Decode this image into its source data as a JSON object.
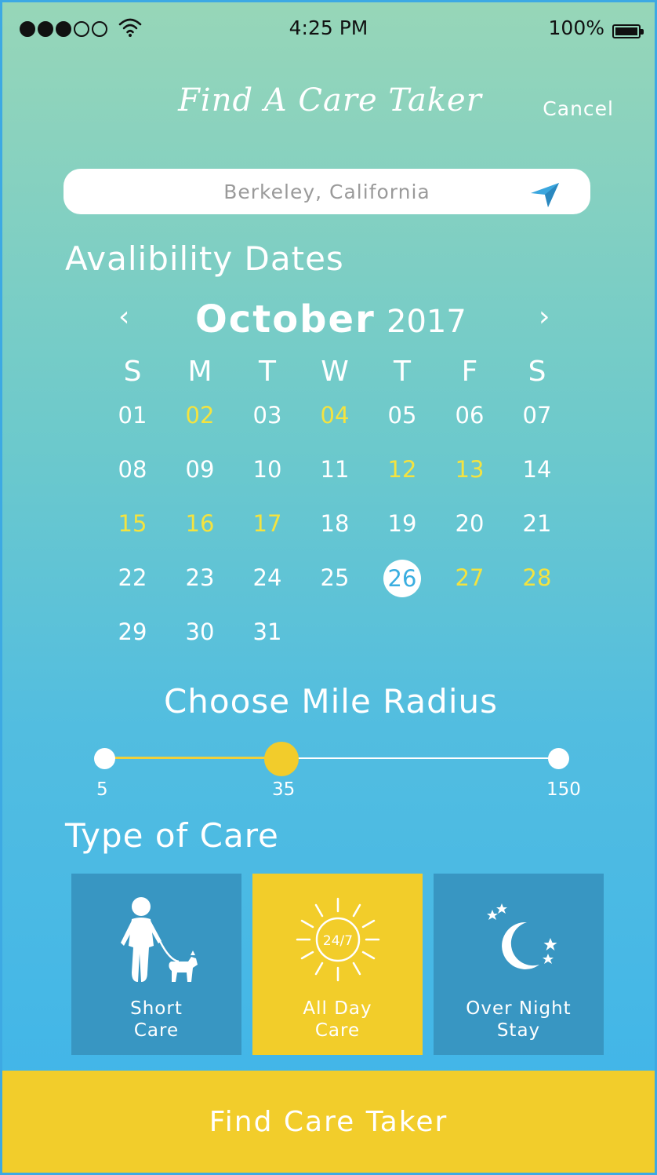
{
  "status_bar": {
    "time": "4:25 PM",
    "battery": "100%"
  },
  "header": {
    "title": "Find A Care Taker",
    "cancel": "Cancel"
  },
  "search": {
    "value": "Berkeley, California"
  },
  "availability": {
    "heading": "Avalibility Dates",
    "month": "October",
    "year": "2017",
    "prev": "‹",
    "next": "›",
    "weekdays": [
      "S",
      "M",
      "T",
      "W",
      "T",
      "F",
      "S"
    ],
    "days": [
      {
        "label": "01",
        "state": "normal"
      },
      {
        "label": "02",
        "state": "avail"
      },
      {
        "label": "03",
        "state": "normal"
      },
      {
        "label": "04",
        "state": "avail"
      },
      {
        "label": "05",
        "state": "normal"
      },
      {
        "label": "06",
        "state": "normal"
      },
      {
        "label": "07",
        "state": "normal"
      },
      {
        "label": "08",
        "state": "normal"
      },
      {
        "label": "09",
        "state": "normal"
      },
      {
        "label": "10",
        "state": "normal"
      },
      {
        "label": "11",
        "state": "normal"
      },
      {
        "label": "12",
        "state": "avail"
      },
      {
        "label": "13",
        "state": "avail"
      },
      {
        "label": "14",
        "state": "normal"
      },
      {
        "label": "15",
        "state": "avail"
      },
      {
        "label": "16",
        "state": "avail"
      },
      {
        "label": "17",
        "state": "avail"
      },
      {
        "label": "18",
        "state": "normal"
      },
      {
        "label": "19",
        "state": "normal"
      },
      {
        "label": "20",
        "state": "normal"
      },
      {
        "label": "21",
        "state": "normal"
      },
      {
        "label": "22",
        "state": "normal"
      },
      {
        "label": "23",
        "state": "normal"
      },
      {
        "label": "24",
        "state": "normal"
      },
      {
        "label": "25",
        "state": "normal"
      },
      {
        "label": "26",
        "state": "selected"
      },
      {
        "label": "27",
        "state": "avail"
      },
      {
        "label": "28",
        "state": "avail"
      },
      {
        "label": "29",
        "state": "normal"
      },
      {
        "label": "30",
        "state": "normal"
      },
      {
        "label": "31",
        "state": "normal"
      }
    ]
  },
  "radius": {
    "heading": "Choose Mile Radius",
    "min": "5",
    "value": "35",
    "max": "150",
    "fraction": 0.39
  },
  "care_types": {
    "heading": "Type of Care",
    "options": [
      {
        "line1": "Short",
        "line2": "Care",
        "icon": "dog-walker-icon",
        "active": false
      },
      {
        "line1": "All Day",
        "line2": "Care",
        "icon": "sun-24-7-icon",
        "icon_text": "24/7",
        "active": true
      },
      {
        "line1": "Over Night",
        "line2": "Stay",
        "icon": "moon-stars-icon",
        "active": false
      }
    ]
  },
  "cta": {
    "label": "Find Care Taker"
  },
  "colors": {
    "accent": "#f2cd2a",
    "highlight": "#f4e33f",
    "tile": "#3896c2"
  }
}
